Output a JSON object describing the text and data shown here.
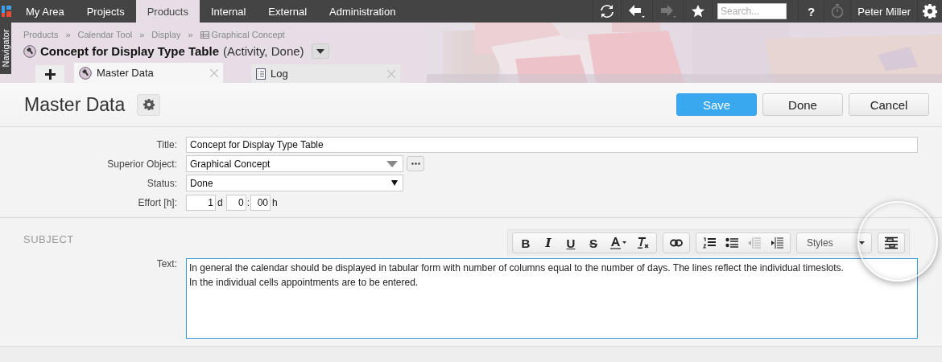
{
  "top_nav": {
    "items": [
      {
        "label": "My Area",
        "selected": false
      },
      {
        "label": "Projects",
        "selected": false
      },
      {
        "label": "Products",
        "selected": true
      },
      {
        "label": "Internal",
        "selected": false
      },
      {
        "label": "External",
        "selected": false
      },
      {
        "label": "Administration",
        "selected": false
      }
    ],
    "tools": [
      {
        "kind": "refresh",
        "disabled": false
      },
      {
        "kind": "back",
        "disabled": false
      },
      {
        "kind": "forward",
        "disabled": true
      },
      {
        "kind": "favorite",
        "disabled": false
      }
    ],
    "search": {
      "placeholder": "Search..."
    },
    "help": "?",
    "timer": {
      "disabled": true
    },
    "user": "Peter Miller"
  },
  "navigator": {
    "label": "Navigator"
  },
  "breadcrumb": {
    "separator": "»",
    "items": [
      {
        "label": "Products",
        "kind": "plain"
      },
      {
        "label": "Calendar Tool",
        "kind": "plain"
      },
      {
        "label": "Display",
        "kind": "plain"
      },
      {
        "label": "Graphical Concept",
        "kind": "object"
      }
    ]
  },
  "object": {
    "title": "Concept for Display Type Table",
    "meta": "(Activity, Done)"
  },
  "tabs": [
    {
      "label": "Master Data",
      "kind": "master",
      "selected": true
    },
    {
      "label": "Log",
      "kind": "log",
      "selected": false
    }
  ],
  "page": {
    "heading": "Master Data",
    "buttons": [
      {
        "label": "Save",
        "kind": "primary"
      },
      {
        "label": "Done",
        "kind": "default"
      },
      {
        "label": "Cancel",
        "kind": "default"
      }
    ]
  },
  "form": {
    "title": {
      "label": "Title:",
      "value": "Concept for Display Type Table"
    },
    "superior": {
      "label": "Superior Object:",
      "value": "Graphical Concept"
    },
    "status": {
      "label": "Status:",
      "value": "Done"
    },
    "effort": {
      "label": "Effort [h]:",
      "days": "1",
      "days_unit": "d",
      "hours": "0",
      "separator": ":",
      "minutes": "00",
      "hours_unit": "h"
    }
  },
  "subject": {
    "heading": "SUBJECT",
    "text_label": "Text:",
    "toolbar": {
      "groups": [
        [
          {
            "kind": "bold",
            "glyph": "B",
            "disabled": false
          },
          {
            "kind": "italic",
            "glyph": "I",
            "disabled": false
          },
          {
            "kind": "underline",
            "glyph": "U",
            "disabled": false
          },
          {
            "kind": "strike",
            "glyph": "S",
            "disabled": false
          },
          {
            "kind": "text-color",
            "disabled": false
          },
          {
            "kind": "clear-format",
            "disabled": false
          }
        ],
        [
          {
            "kind": "link",
            "disabled": false
          }
        ],
        [
          {
            "kind": "numbered-list",
            "disabled": false
          },
          {
            "kind": "bullet-list",
            "disabled": false
          },
          {
            "kind": "outdent",
            "disabled": true
          },
          {
            "kind": "indent",
            "disabled": false
          }
        ]
      ],
      "styles": "Styles"
    },
    "lines": [
      "In general the calendar should be displayed in tabular form with number of columns equal to the number of days. The lines reflect the individual timeslots.",
      "In the individual cells appointments are to be entered."
    ]
  }
}
